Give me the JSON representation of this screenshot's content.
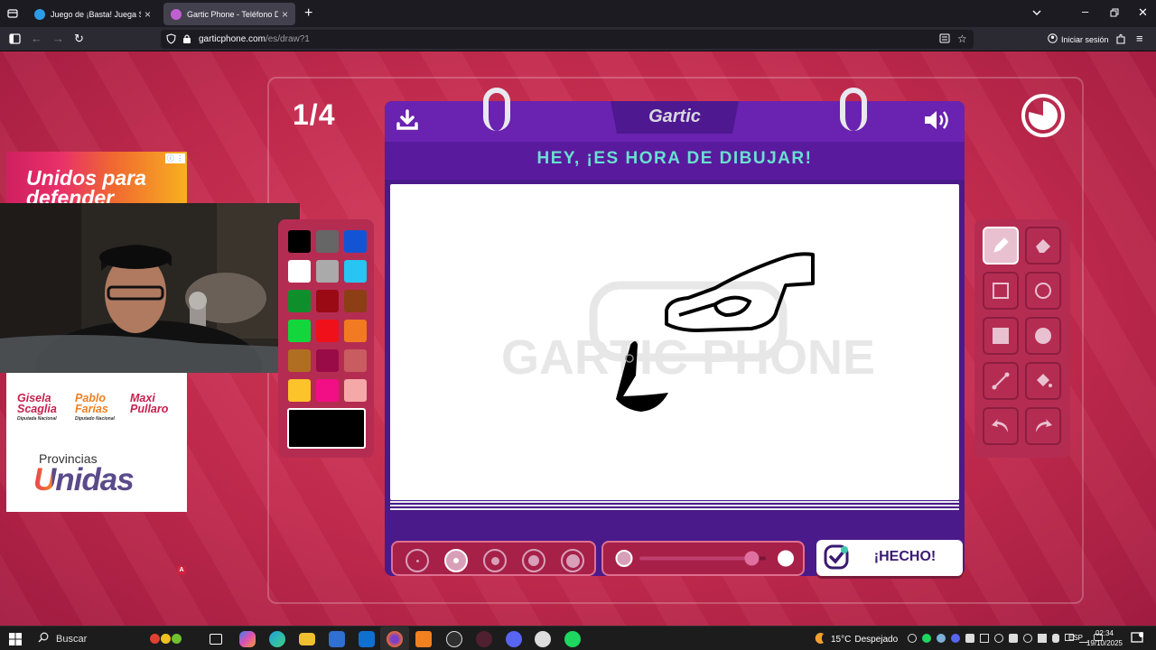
{
  "browser": {
    "tabs": [
      {
        "title": "Juego de ¡Basta! Juega Stop, Tu",
        "active": false
      },
      {
        "title": "Gartic Phone - Teléfono Descon",
        "active": true
      }
    ],
    "url_host": "garticphone.com",
    "url_path": "/es/draw?1",
    "signin_label": "Iniciar sesión"
  },
  "game": {
    "round_counter": "1/4",
    "logo": "Gartic",
    "heading": "HEY, ¡ES HORA DE DIBUJAR!",
    "watermark": "GARTIC PHONE",
    "done_label": "¡HECHO!",
    "current_color": "#000000",
    "palette": [
      [
        "#000000",
        "#666666",
        "#1254d4"
      ],
      [
        "#ffffff",
        "#aaaaaa",
        "#28c4f2"
      ],
      [
        "#0f8f2c",
        "#9a0a14",
        "#8c3e14"
      ],
      [
        "#12d63c",
        "#f0101a",
        "#f27a22"
      ],
      [
        "#b06e22",
        "#990b46",
        "#c85c60"
      ],
      [
        "#fcc32a",
        "#f20e84",
        "#f5a8a8"
      ]
    ],
    "tools": [
      "pencil-tool",
      "eraser-tool",
      "rectangle-outline-tool",
      "circle-outline-tool",
      "rectangle-fill-tool",
      "circle-fill-tool",
      "line-tool",
      "bucket-fill-tool",
      "undo-tool",
      "redo-tool"
    ],
    "selected_tool": "pencil-tool",
    "brush_sizes": 5,
    "selected_brush_size": 2,
    "opacity_level": 0.9
  },
  "ads": {
    "top_text": "Unidos para defender",
    "candidates": [
      {
        "name1": "Gisela",
        "name2": "Scaglia",
        "role": "Diputada Nacional"
      },
      {
        "name1": "Pablo",
        "name2": "Farías",
        "role": "Diputado Nacional"
      },
      {
        "name1": "Maxi",
        "name2": "Pullaro",
        "role": ""
      }
    ],
    "brand_top": "Provincias",
    "brand_bottom": "Unidas",
    "badge": "A"
  },
  "taskbar": {
    "search_label": "Buscar",
    "weather_temp": "15°C",
    "weather_desc": "Despejado",
    "language": "ESP",
    "time": "02:34",
    "date": "19/10/2025"
  }
}
